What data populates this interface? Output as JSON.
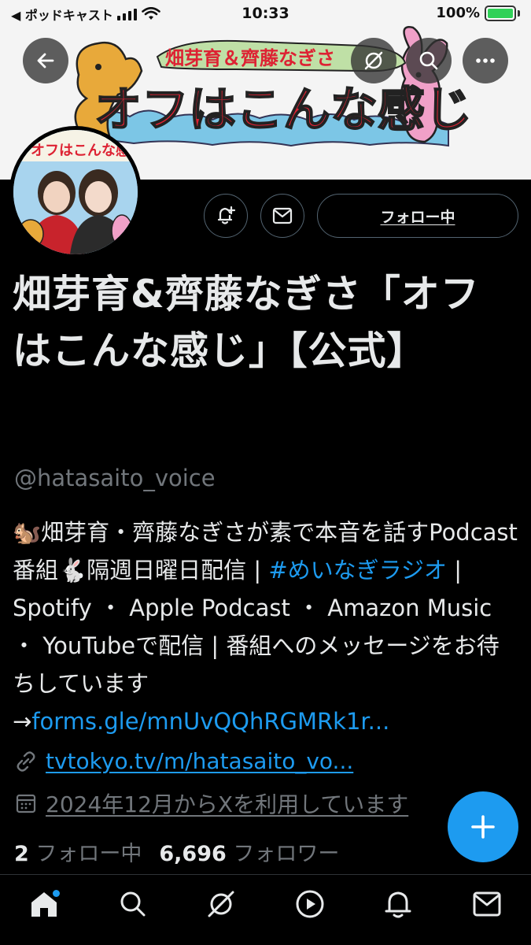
{
  "status_bar": {
    "carrier": "◀ ポッドキャスト",
    "time": "10:33",
    "battery": "100%",
    "battery_level": 1.0
  },
  "banner": {
    "title_top": "畑芽育＆齊藤なぎさ",
    "title_main": "オフはこんな感じ"
  },
  "avatar": {
    "logo_text": "オフはこんな感じ"
  },
  "actions": {
    "follow_label": "フォロー中"
  },
  "profile": {
    "display_name": "畑芽育&齊藤なぎさ「オフはこんな感じ」【公式】",
    "handle": "@hatasaito_voice",
    "bio_part1": "🐿️畑芽育・齊藤なぎさが素で本音を話すPodcast番組🐇隔週日曜日配信 | ",
    "bio_hashtag": "#めいなぎラジオ",
    "bio_part2": " | Spotify ・ Apple Podcast ・ Amazon Music ・ YouTubeで配信 | 番組へのメッセージをお待ちしています→",
    "bio_link": "forms.gle/mnUvQQhRGMRk1r...",
    "url": "tvtokyo.tv/m/hatasaito_vo...",
    "joined": "2024年12月からXを利用しています"
  },
  "stats": {
    "following_count": "2",
    "following_label": "フォロー中",
    "followers_count": "6,696",
    "followers_label": "フォロワー"
  },
  "tabs": [
    "home-icon",
    "search-icon",
    "grok-icon",
    "play-icon",
    "notifications-icon",
    "messages-icon"
  ],
  "colors": {
    "accent": "#1d9bf0",
    "background": "#000000",
    "muted": "#71767b"
  }
}
